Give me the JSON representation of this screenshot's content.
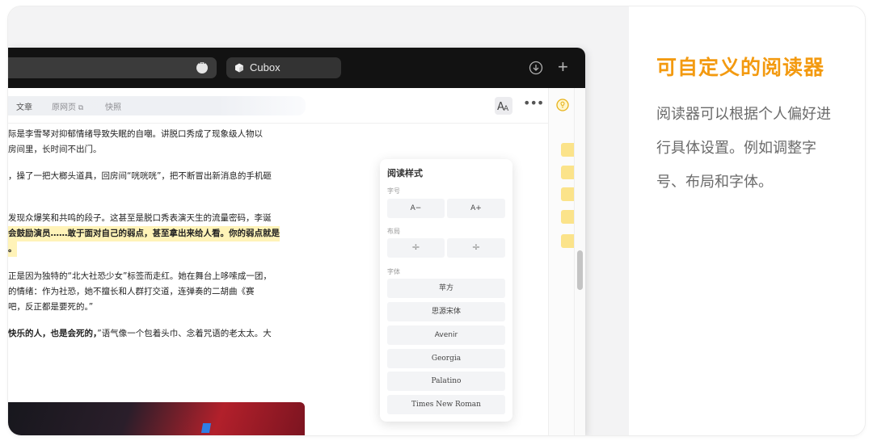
{
  "window": {
    "tab_title": "Cubox"
  },
  "toolbar": {
    "view_tabs": [
      {
        "label": "文章",
        "active": true
      },
      {
        "label": "原网页",
        "external_icon": "external-link-icon"
      },
      {
        "label": "快照"
      }
    ],
    "font_button_glyph": "A",
    "more_glyph": "•••"
  },
  "article": {
    "paragraphs": [
      [
        "际是李雪琴对抑郁情绪导致失眠的自嘲。讲脱口秀成了现象级人物以",
        "房间里，长时间不出门。"
      ],
      [
        "，操了一把大榔头道具，回房间“咣咣咣”，把不断冒出新消息的手机砸"
      ],
      [
        "发现众爆笑和共鸣的段子。这甚至是脱口秀表演天生的流量密码，李诞",
        "会鼓励演员……敢于面对自己的弱点，甚至拿出来给人看。你的弱点就是",
        "。"
      ],
      [
        "正是因为独特的“北大社恐少女”标签而走红。她在舞台上哆嗦成一团，",
        "的情绪：作为社恐，她不擅长和人群打交道，连弹奏的二胡曲《赛",
        "吧，反正都是要死的。”"
      ],
      [
        "快乐的人，也是会死的，",
        "”语气像一个包着头巾、念着咒语的老太太。大"
      ]
    ]
  },
  "reading_style": {
    "title": "阅读样式",
    "size_label": "字号",
    "size_options": [
      "A−",
      "A+"
    ],
    "layout_label": "布局",
    "layout_options": [
      "÷",
      "÷"
    ],
    "font_label": "字体",
    "fonts": [
      "苹方",
      "思源宋体",
      "Avenir",
      "Georgia",
      "Palatino",
      "Times New Roman"
    ]
  },
  "feature": {
    "title": "可自定义的阅读器",
    "description": "阅读器可以根据个人偏好进行具体设置。例如调整字号、布局和字体。"
  },
  "colors": {
    "accent": "#f39a10",
    "highlight": "#fff3b8",
    "titlebar": "#121212"
  }
}
